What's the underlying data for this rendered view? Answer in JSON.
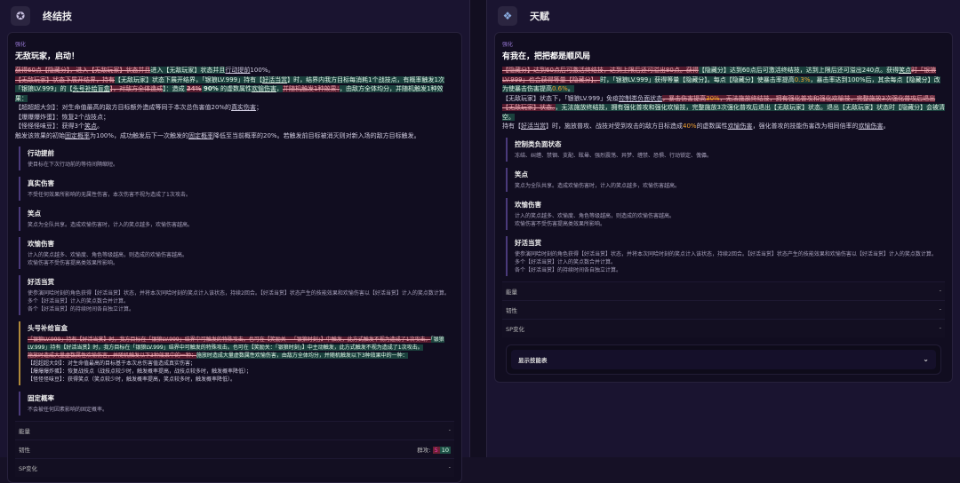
{
  "left": {
    "title": "终结技",
    "icon": "skill-emblem-icon",
    "tag": "强化",
    "skill_name": "无敌玩家，启动！",
    "desc": [
      [
        {
          "t": "获得60点【隐藏分】，进入【无敌玩家】状态并且",
          "c": "del"
        },
        {
          "t": "进入【无敌玩家】状态并且",
          "c": "ins"
        },
        {
          "t": "行动提前",
          "c": "u"
        },
        {
          "t": "100%。",
          "c": ""
        }
      ],
      [
        {
          "t": "【无敌玩家】状态下展开结界，持有",
          "c": "del"
        },
        {
          "t": "【无敌玩家】状态下展开结界，「银狼LV.999」持有【",
          "c": "ins"
        },
        {
          "t": "好活当赏",
          "c": "ins u"
        },
        {
          "t": "】时，结界内我方目标每消耗1个战技点，有概率触发1次「银狼LV.999」的【",
          "c": "ins"
        },
        {
          "t": "头号补给盲盒",
          "c": "ins u"
        },
        {
          "t": "】，对敌方全体造成",
          "c": "del"
        },
        {
          "t": "】：造成 ",
          "c": "ins"
        },
        {
          "t": "34%",
          "c": "del b"
        },
        {
          "t": " 90%",
          "c": "ins b"
        },
        {
          "t": " 的虚数属性",
          "c": "ins"
        },
        {
          "t": "欢愉伤害",
          "c": "ins u"
        },
        {
          "t": "，",
          "c": "ins"
        },
        {
          "t": "并随机触发1种效果：",
          "c": "del"
        },
        {
          "t": "，由敌方全体均分，并随机触发1种效果：",
          "c": "ins"
        }
      ],
      [
        {
          "t": "【超超超大剑】：对生命值最高的敌方目标额外造成等同于本次总伤害值20%的",
          "c": ""
        },
        {
          "t": "真实伤害",
          "c": "u"
        },
        {
          "t": "；",
          "c": ""
        }
      ],
      [
        {
          "t": "【爆爆爆炸蛋】：恢复2个战技点；",
          "c": ""
        }
      ],
      [
        {
          "t": "【怪怪怪味豆】：获得3个",
          "c": ""
        },
        {
          "t": "笑点",
          "c": "u"
        },
        {
          "t": "。",
          "c": ""
        }
      ],
      [
        {
          "t": "触发该效果的初始",
          "c": ""
        },
        {
          "t": "固定概率",
          "c": "u"
        },
        {
          "t": "为100%，成功触发后下一次触发的",
          "c": ""
        },
        {
          "t": "固定概率",
          "c": "u"
        },
        {
          "t": "降低至当前概率的20%。若触发前目标被消灭则对新入场的敌方目标触发。",
          "c": ""
        }
      ]
    ],
    "glossary": [
      {
        "title": "行动提前",
        "lines": [
          "使目标在下次行动前的等待间隔缩短。"
        ]
      },
      {
        "title": "真实伤害",
        "lines": [
          "不受任何效果所影响的无属性伤害，本次伤害不视为造成了1次攻击。"
        ]
      },
      {
        "title": "笑点",
        "lines": [
          "笑点为全队共享。造成欢愉伤害时，计入的笑点越多，欢愉伤害越高。"
        ]
      },
      {
        "title": "欢愉伤害",
        "lines": [
          "计入的笑点越多、欢愉度、角色等级越高，则造成的欢愉伤害越高。",
          "欢愉伤害不受伤害提高类效果所影响。"
        ]
      },
      {
        "title": "好活当赏",
        "lines": [
          "使参演同哈时刻的角色获得【好活当赏】状态，并将本次同哈时刻的笑点计入该状态，持续2回合。【好活当赏】状态产生的技能效果和欢愉伤害以【好活当赏】计入的笑点数计算。",
          "多个【好活当赏】计入的笑点数合并计算。",
          "各个【好活当赏】的持续时间各自独立计算。"
        ]
      }
    ],
    "blindbox": {
      "title": "头号补给盲盒",
      "desc": [
        [
          {
            "t": "「银狼LV.999」持有【好活当赏】时，我方目标在「银狼LV.999」结界中可触发的特殊攻击。也可在【笑励关 - 「银狼时刻」】中触发，此方式触发不视为造成了1次攻击。",
            "c": "del"
          },
          {
            "t": "「银狼LV.999」持有【好活当赏】时，我方目标在「银狼LV.999」结界中可触发的特殊攻击。也可在【笑励关：「银狼时刻」】中主动触发，此方式触发不视为造成了1次攻击。",
            "c": "ins"
          }
        ],
        [
          {
            "t": "施放时造成大量虚数属性欢愉伤害，并随机触发以下3种效果中的一种：",
            "c": "del"
          },
          {
            "t": "施放时造成大量虚数属性欢愉伤害，由敌方全体均分，并随机触发以下3种效果中的一种：",
            "c": "ins"
          }
        ],
        [
          {
            "t": "【超超超大剑】：对生命值最高的目标基于本次总伤害值造成真实伤害；",
            "c": ""
          }
        ],
        [
          {
            "t": "【爆爆爆炸蛋】：恢复战技点（战技点较少时，触发概率提高，战技点较多时，触发概率降低）；",
            "c": ""
          }
        ],
        [
          {
            "t": "【怪怪怪味豆】：获得笑点（笑点较少时，触发概率提高，笑点较多时，触发概率降低）。",
            "c": ""
          }
        ]
      ]
    },
    "glossary2": [
      {
        "title": "固定概率",
        "lines": [
          "不会被任何因素影响的固定概率。"
        ]
      }
    ],
    "stats": {
      "energy_label": "能量",
      "energy_value": "-",
      "toughness_label": "韧性",
      "toughness_prefix": "群攻:",
      "toughness_old": "5",
      "toughness_new": "10",
      "sp_label": "SP变化",
      "sp_value": "-"
    }
  },
  "right": {
    "title": "天赋",
    "icon": "talent-emblem-icon",
    "tag": "强化",
    "skill_name": "有我在，把把都是顺风局",
    "desc": [
      [
        {
          "t": "【隐藏分】达到60点后可激活终结技，达到上限后还可溢出80点。获得",
          "c": "del"
        },
        {
          "t": "【隐藏分】达到60点后可激活终结技，达到上限后还可溢出240点。获得",
          "c": "ins"
        },
        {
          "t": "笑点",
          "c": "ins u"
        },
        {
          "t": "时「银狼LV.999」也会获得等量【隐藏分】。",
          "c": "del"
        },
        {
          "t": "时，「银狼LV.999」获得等量【隐藏分】。每点【隐藏分】使暴击率提高",
          "c": "ins"
        },
        {
          "t": "0.3%",
          "c": "ins pct"
        },
        {
          "t": "，暴击率达到100%后，其余每点【隐藏分】改为使暴击伤害提高",
          "c": "ins"
        },
        {
          "t": "0.6%",
          "c": "ins pct"
        },
        {
          "t": "。",
          "c": "ins"
        }
      ],
      [
        {
          "t": "【无敌玩家】状态下，「银狼LV.999」免疫",
          "c": ""
        },
        {
          "t": "控制类负面状态",
          "c": "u"
        },
        {
          "t": "，暴击伤害提高",
          "c": "del"
        },
        {
          "t": "30%",
          "c": "del pct"
        },
        {
          "t": "，无法施放终结技，拥有强化普攻和强化欢愉技，完整施放3次强化普攻后退出【无敌玩家】状态。",
          "c": "del"
        },
        {
          "t": "，无法施放终结技，拥有强化普攻和强化欢愉技，完整施放3次强化普攻后退出【无敌玩家】状态。退出【无敌玩家】状态时【隐藏分】会被清空。",
          "c": "ins"
        }
      ],
      [
        {
          "t": "持有【",
          "c": ""
        },
        {
          "t": "好活当赏",
          "c": "u"
        },
        {
          "t": "】时，施放普攻、战技对受到攻击的敌方目标造成",
          "c": ""
        },
        {
          "t": "40%",
          "c": "pct"
        },
        {
          "t": "的虚数属性",
          "c": ""
        },
        {
          "t": "欢愉伤害",
          "c": "u"
        },
        {
          "t": "，强化普攻的技能伤害改为相同倍率的",
          "c": ""
        },
        {
          "t": "欢愉伤害",
          "c": "u"
        },
        {
          "t": "。",
          "c": ""
        }
      ]
    ],
    "glossary": [
      {
        "title": "控制类负面状态",
        "lines": [
          "冻结、纠缠、禁锢、支配、眩晕、强烈震荡、异梦、缠禁、恐惧、行动锁定、傀儡。"
        ]
      },
      {
        "title": "笑点",
        "lines": [
          "笑点为全队共享。造成欢愉伤害时，计入的笑点越多，欢愉伤害越高。"
        ]
      },
      {
        "title": "欢愉伤害",
        "lines": [
          "计入的笑点越多、欢愉度、角色等级越高，则造成的欢愉伤害越高。",
          "欢愉伤害不受伤害提高类效果所影响。"
        ]
      },
      {
        "title": "好活当赏",
        "lines": [
          "使参演同哈时刻的角色获得【好活当赏】状态，并将本次同哈时刻的笑点计入该状态，持续2回合。【好活当赏】状态产生的技能效果和欢愉伤害以【好活当赏】计入的笑点数计算。",
          "多个【好活当赏】计入的笑点数合并计算。",
          "各个【好活当赏】的持续时间各自独立计算。"
        ]
      }
    ],
    "stats": {
      "energy_label": "能量",
      "energy_value": "-",
      "toughness_label": "韧性",
      "toughness_value": "-",
      "sp_label": "SP变化",
      "sp_value": "-"
    },
    "dropdown": {
      "label": "显示技能表",
      "icon": "chevron-down-icon"
    }
  },
  "colors": {
    "deleted": "#aa2d41",
    "inserted": "#236e55",
    "percent": "#f0a030",
    "accent": "#9a7ad8"
  }
}
